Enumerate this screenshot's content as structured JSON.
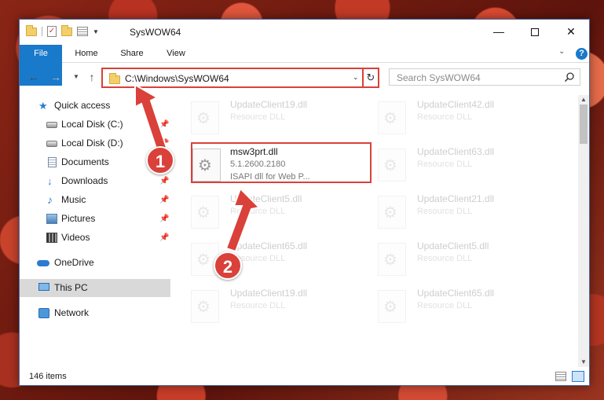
{
  "window": {
    "title": "SysWOW64"
  },
  "ribbon": {
    "tabs": [
      {
        "label": "File"
      },
      {
        "label": "Home"
      },
      {
        "label": "Share"
      },
      {
        "label": "View"
      }
    ]
  },
  "address": {
    "path": "C:\\Windows\\SysWOW64"
  },
  "search": {
    "placeholder": "Search SysWOW64"
  },
  "sidebar": {
    "items": [
      {
        "label": "Quick access",
        "icon": "star-icon"
      },
      {
        "label": "Local Disk (C:)",
        "icon": "drive-icon"
      },
      {
        "label": "Local Disk (D:)",
        "icon": "drive-icon"
      },
      {
        "label": "Documents",
        "icon": "documents-icon"
      },
      {
        "label": "Downloads",
        "icon": "download-icon"
      },
      {
        "label": "Music",
        "icon": "music-icon"
      },
      {
        "label": "Pictures",
        "icon": "pictures-icon"
      },
      {
        "label": "Videos",
        "icon": "videos-icon"
      },
      {
        "label": "OneDrive",
        "icon": "cloud-icon"
      },
      {
        "label": "This PC",
        "icon": "pc-icon"
      },
      {
        "label": "Network",
        "icon": "network-icon"
      }
    ]
  },
  "files": {
    "highlighted": {
      "name": "msw3prt.dll",
      "version": "5.1.2600.2180",
      "description": "ISAPI dll for Web P..."
    },
    "ghost": [
      {
        "name": "UpdateClient19.dll",
        "type": "Resource DLL"
      },
      {
        "name": "UpdateClient42.dll",
        "type": "Resource DLL"
      },
      {
        "name": "UpdateClient63.dll",
        "type": "Resource DLL"
      },
      {
        "name": "UpdateClient5.dll",
        "type": "Resource DLL"
      },
      {
        "name": "UpdateClient21.dll",
        "type": "Resource DLL"
      },
      {
        "name": "UpdateClient65.dll",
        "type": "Resource DLL"
      },
      {
        "name": "UpdateClient5.dll",
        "type": "Resource DLL"
      },
      {
        "name": "UpdateClient19.dll",
        "type": "Resource DLL"
      },
      {
        "name": "UpdateClient65.dll",
        "type": "Resource DLL"
      }
    ]
  },
  "annotations": {
    "step1": "1",
    "step2": "2"
  },
  "status": {
    "item_count": "146 items"
  },
  "colors": {
    "accent": "#1979ca",
    "highlight": "#d9413a"
  }
}
